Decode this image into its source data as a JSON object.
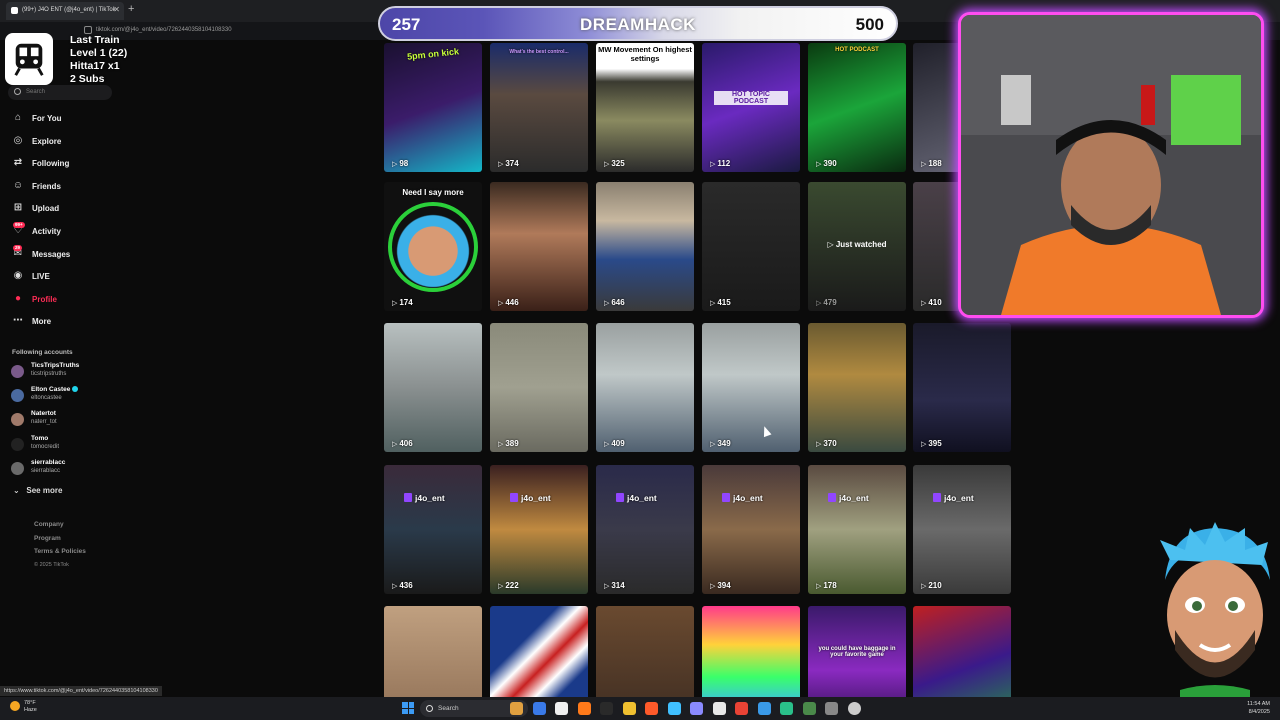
{
  "browser": {
    "tab_title": "(99+) J4O ENT (@j4o_ent) | TikTok",
    "url": "tiktok.com/@j4o_ent/video/7262440358104108330"
  },
  "stream_overlay": {
    "train_title": "Last Train",
    "train_level": "Level 1  (22)",
    "train_user": "Hitta17 x1",
    "train_subs": "2 Subs",
    "score_left": "257",
    "score_title": "DREAMHACK",
    "score_right": "500"
  },
  "sidebar": {
    "search_placeholder": "Search",
    "nav": [
      {
        "label": "For You",
        "icon": "home-icon",
        "glyph": "⌂"
      },
      {
        "label": "Explore",
        "icon": "compass-icon",
        "glyph": "◎"
      },
      {
        "label": "Following",
        "icon": "following-icon",
        "glyph": "⇄"
      },
      {
        "label": "Friends",
        "icon": "friends-icon",
        "glyph": "☺"
      },
      {
        "label": "Upload",
        "icon": "upload-icon",
        "glyph": "⊞"
      },
      {
        "label": "Activity",
        "icon": "activity-icon",
        "glyph": "♡",
        "badge": "99+"
      },
      {
        "label": "Messages",
        "icon": "messages-icon",
        "glyph": "✉",
        "badge": "29"
      },
      {
        "label": "LIVE",
        "icon": "live-icon",
        "glyph": "◉"
      },
      {
        "label": "Profile",
        "icon": "profile-icon",
        "glyph": "●"
      },
      {
        "label": "More",
        "icon": "more-icon",
        "glyph": "⋯"
      }
    ],
    "following_title": "Following accounts",
    "following": [
      {
        "name": "TicsTripsTruths",
        "handle": "ticstripstruths",
        "verified": false,
        "color": "#7a5a8a"
      },
      {
        "name": "Elton Castee",
        "handle": "eltoncastee",
        "verified": true,
        "color": "#4a6aa0"
      },
      {
        "name": "Natertot",
        "handle": "naterr_tot",
        "verified": false,
        "color": "#a07a6a"
      },
      {
        "name": "Tomo",
        "handle": "tomocredit",
        "verified": false,
        "color": "#222222"
      },
      {
        "name": "sierrablacc",
        "handle": "sierrablacc",
        "verified": false,
        "color": "#6a6a6a"
      }
    ],
    "see_more": "See more",
    "footer": [
      "Company",
      "Program",
      "Terms & Policies"
    ],
    "copyright": "© 2025 TikTok"
  },
  "grid": {
    "rows": [
      [
        {
          "views": "98",
          "caption": "5pm on kick",
          "bg": "linear-gradient(160deg,#1a1030,#3b1c6a 50%,#14b8c8)"
        },
        {
          "views": "374",
          "caption": "What's the best control...",
          "bg": "linear-gradient(180deg,#1a2b6a,#5a4a40 40%,#2b2b2b)"
        },
        {
          "views": "325",
          "caption": "MW Movement On highest settings",
          "bg": "linear-gradient(180deg,#ffffff 0%,#ffffff 20%,#3a3a30 30%,#8a8a60 60%,#2b2b2b)"
        },
        {
          "views": "112",
          "caption": "HOT TOPIC PODCAST",
          "bg": "linear-gradient(160deg,#2a1a6a,#6a2ac0 50%,#1a1a40)"
        },
        {
          "views": "390",
          "caption": "HOT PODCAST",
          "bg": "linear-gradient(160deg,#0a3a10,#1ba53a 50%,#0a2a10)"
        },
        {
          "views": "188",
          "caption": "",
          "bg": "linear-gradient(160deg,#20202a,#6a6a7a)"
        }
      ],
      [
        {
          "views": "174",
          "caption": "Need I say more",
          "bg": "#101010"
        },
        {
          "views": "446",
          "caption": "",
          "bg": "linear-gradient(180deg,#3a2a20,#b07a5a 40%,#3a2018)"
        },
        {
          "views": "646",
          "caption": "",
          "bg": "linear-gradient(180deg,#8a8070,#c8b8a0 30%,#2a4a8a 60%,#3a3a3a)"
        },
        {
          "views": "415",
          "caption": "",
          "bg": "linear-gradient(180deg,#2a2a2a,#1a1a1a)"
        },
        {
          "views": "479",
          "caption": "",
          "bg": "linear-gradient(180deg,#3a4a30,#1a1a1a)",
          "just_watched": "Just watched"
        },
        {
          "views": "410",
          "caption": "",
          "bg": "linear-gradient(180deg,#4a4048,#2a2a2a)"
        }
      ],
      [
        {
          "views": "406",
          "caption": "",
          "bg": "linear-gradient(180deg,#b8c0c0,#8a9090 50%,#506060)"
        },
        {
          "views": "389",
          "caption": "",
          "bg": "linear-gradient(180deg,#8a8a7a,#a0a090 50%,#6a6a60)"
        },
        {
          "views": "409",
          "caption": "",
          "bg": "linear-gradient(180deg,#9aa0a0,#c0c8c8 40%,#506070)"
        },
        {
          "views": "349",
          "caption": "",
          "bg": "linear-gradient(180deg,#9aa0a0,#c0c8c8 40%,#506070)"
        },
        {
          "views": "370",
          "caption": "",
          "bg": "linear-gradient(180deg,#6a5a30,#b08a40 40%,#3a4a40)"
        },
        {
          "views": "395",
          "caption": "",
          "bg": "linear-gradient(180deg,#1a1a2a,#2a2a4a 60%,#101020)"
        }
      ],
      [
        {
          "views": "436",
          "caption": "j4o_ent",
          "bg": "linear-gradient(180deg,#3a2a3a,#2a3a4a 50%,#1a1a1a)"
        },
        {
          "views": "222",
          "caption": "j4o_ent",
          "bg": "linear-gradient(180deg,#3a2020,#c08a40 50%,#2a3a2a)"
        },
        {
          "views": "314",
          "caption": "j4o_ent",
          "bg": "linear-gradient(180deg,#2a2a4a,#3a3a4a 50%,#2a2a2a)"
        },
        {
          "views": "394",
          "caption": "j4o_ent",
          "bg": "linear-gradient(180deg,#4a3a3a,#8a6a4a 50%,#3a2a20)"
        },
        {
          "views": "178",
          "caption": "j4o_ent",
          "bg": "linear-gradient(180deg,#5a4a40,#a0a080 50%,#4a5a30)"
        },
        {
          "views": "210",
          "caption": "j4o_ent",
          "bg": "linear-gradient(180deg,#3a3a3a,#6a6a6a 50%,#3a3a3a)"
        }
      ],
      [
        {
          "views": "",
          "caption": "",
          "bg": "linear-gradient(180deg,#c0a080,#8a6a50)"
        },
        {
          "views": "",
          "caption": "",
          "bg": "linear-gradient(135deg,#1a3a8a 30%,#ffffff 40%,#c82020 50%,#ffffff 60%,#1a3a8a 70%)"
        },
        {
          "views": "",
          "caption": "",
          "bg": "linear-gradient(180deg,#6a4a30,#3a2a20)"
        },
        {
          "views": "",
          "caption": "",
          "bg": "linear-gradient(180deg,#ff3a8a,#ffd23a 30%,#3aff6a 55%,#3ab0ff 80%,#8a3aff)"
        },
        {
          "views": "",
          "caption": "you could have baggage in your favorite game",
          "bg": "linear-gradient(180deg,#3a1a6a,#8a2ac0 50%,#1a0a3a)"
        },
        {
          "views": "",
          "caption": "",
          "bg": "linear-gradient(160deg,#c02020,#3a1a8a 50%,#20a03a)"
        }
      ]
    ]
  },
  "status_url": "https://www.tiktok.com/@j4o_ent/video/7262440358104108330",
  "taskbar": {
    "temperature": "78°F",
    "weather": "Haze",
    "search_placeholder": "Search",
    "time": "11:54 AM",
    "date": "8/4/2025"
  },
  "colors": {
    "accent": "#fe2c55",
    "twitch": "#9146ff",
    "webcam_border": "#ff4df0"
  }
}
